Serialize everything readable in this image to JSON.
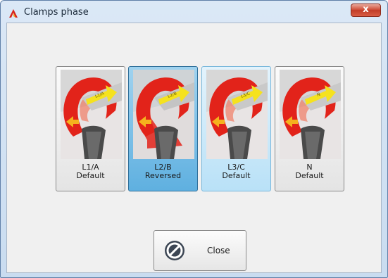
{
  "window": {
    "title": "Clamps phase",
    "close_glyph": "x",
    "app_icon": "red-logo-icon"
  },
  "clamps": [
    {
      "phase": "L1/A",
      "state": "Default",
      "tag": "L1/A",
      "style": "normal"
    },
    {
      "phase": "L2/B",
      "state": "Reversed",
      "tag": "L2/B",
      "style": "selected"
    },
    {
      "phase": "L3/C",
      "state": "Default",
      "tag": "L3/C",
      "style": "hover"
    },
    {
      "phase": "N",
      "state": "Default",
      "tag": "N",
      "style": "normal"
    }
  ],
  "close_button": {
    "label": "Close",
    "icon": "close-circle-icon"
  },
  "colors": {
    "clamp_red": "#e2231a",
    "arrow_yellow": "#f5e21e",
    "selected_bg": "#6cb8e4",
    "hover_bg": "#c9e8f9"
  }
}
